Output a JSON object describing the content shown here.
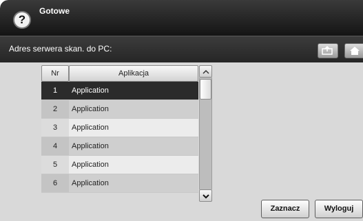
{
  "header": {
    "help_icon": "?",
    "status": "Gotowe"
  },
  "subheader": {
    "title": "Adres serwera skan. do PC:",
    "back_icon": "back-arrow-icon",
    "home_icon": "home-icon"
  },
  "table": {
    "columns": {
      "nr": "Nr",
      "app": "Aplikacja"
    },
    "rows": [
      {
        "nr": "1",
        "app": "Application"
      },
      {
        "nr": "2",
        "app": "Application"
      },
      {
        "nr": "3",
        "app": "Application"
      },
      {
        "nr": "4",
        "app": "Application"
      },
      {
        "nr": "5",
        "app": "Application"
      },
      {
        "nr": "6",
        "app": "Application"
      }
    ],
    "selected_index": 0
  },
  "buttons": {
    "select": "Zaznacz",
    "logout": "Wyloguj"
  },
  "colors": {
    "header": "#1e1e1e",
    "background": "#d9d9d9",
    "selected_row": "#2b2b2b"
  }
}
